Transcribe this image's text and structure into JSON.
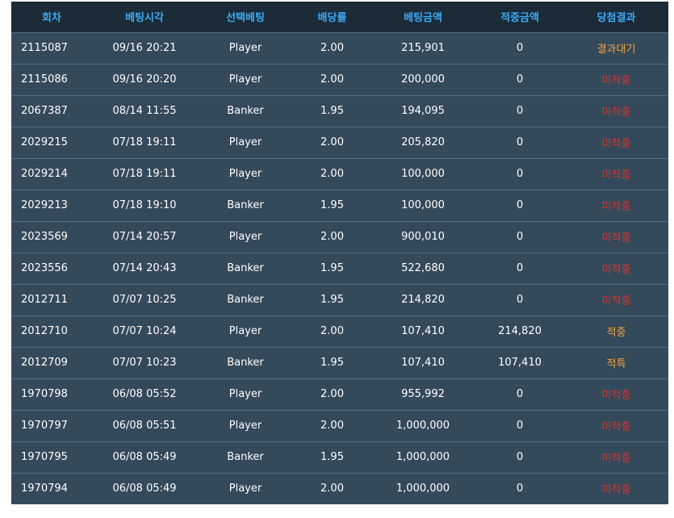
{
  "headers": [
    "회차",
    "베팅시각",
    "선택베팅",
    "배당률",
    "베팅금액",
    "적중금액",
    "당첨결과"
  ],
  "rows": [
    {
      "round": "2115087",
      "time": "09/16 20:21",
      "pick": "Player",
      "odds": "2.00",
      "bet": "215,901",
      "win": "0",
      "result": "결과대기",
      "status": "wait"
    },
    {
      "round": "2115086",
      "time": "09/16 20:20",
      "pick": "Player",
      "odds": "2.00",
      "bet": "200,000",
      "win": "0",
      "result": "미적중",
      "status": "lose"
    },
    {
      "round": "2067387",
      "time": "08/14 11:55",
      "pick": "Banker",
      "odds": "1.95",
      "bet": "194,095",
      "win": "0",
      "result": "미적중",
      "status": "lose"
    },
    {
      "round": "2029215",
      "time": "07/18 19:11",
      "pick": "Player",
      "odds": "2.00",
      "bet": "205,820",
      "win": "0",
      "result": "미적중",
      "status": "lose"
    },
    {
      "round": "2029214",
      "time": "07/18 19:11",
      "pick": "Player",
      "odds": "2.00",
      "bet": "100,000",
      "win": "0",
      "result": "미적중",
      "status": "lose"
    },
    {
      "round": "2029213",
      "time": "07/18 19:10",
      "pick": "Banker",
      "odds": "1.95",
      "bet": "100,000",
      "win": "0",
      "result": "미적중",
      "status": "lose"
    },
    {
      "round": "2023569",
      "time": "07/14 20:57",
      "pick": "Player",
      "odds": "2.00",
      "bet": "900,010",
      "win": "0",
      "result": "미적중",
      "status": "lose"
    },
    {
      "round": "2023556",
      "time": "07/14 20:43",
      "pick": "Banker",
      "odds": "1.95",
      "bet": "522,680",
      "win": "0",
      "result": "미적중",
      "status": "lose"
    },
    {
      "round": "2012711",
      "time": "07/07 10:25",
      "pick": "Banker",
      "odds": "1.95",
      "bet": "214,820",
      "win": "0",
      "result": "미적중",
      "status": "lose"
    },
    {
      "round": "2012710",
      "time": "07/07 10:24",
      "pick": "Player",
      "odds": "2.00",
      "bet": "107,410",
      "win": "214,820",
      "result": "적중",
      "status": "win"
    },
    {
      "round": "2012709",
      "time": "07/07 10:23",
      "pick": "Banker",
      "odds": "1.95",
      "bet": "107,410",
      "win": "107,410",
      "result": "적특",
      "status": "win"
    },
    {
      "round": "1970798",
      "time": "06/08 05:52",
      "pick": "Player",
      "odds": "2.00",
      "bet": "955,992",
      "win": "0",
      "result": "미적중",
      "status": "lose"
    },
    {
      "round": "1970797",
      "time": "06/08 05:51",
      "pick": "Player",
      "odds": "2.00",
      "bet": "1,000,000",
      "win": "0",
      "result": "미적중",
      "status": "lose"
    },
    {
      "round": "1970795",
      "time": "06/08 05:49",
      "pick": "Banker",
      "odds": "1.95",
      "bet": "1,000,000",
      "win": "0",
      "result": "미적중",
      "status": "lose"
    },
    {
      "round": "1970794",
      "time": "06/08 05:49",
      "pick": "Player",
      "odds": "2.00",
      "bet": "1,000,000",
      "win": "0",
      "result": "미적중",
      "status": "lose"
    }
  ],
  "colors": {
    "header_bg": "#1b2b38",
    "header_text": "#3ea9f0",
    "row_bg": "#34495a",
    "wait": "#f3a23c",
    "lose": "#e0302c",
    "win": "#f3a23c"
  }
}
